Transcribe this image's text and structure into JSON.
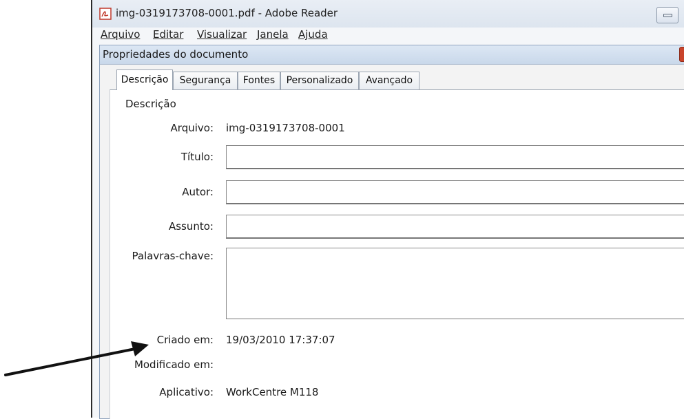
{
  "window": {
    "title": "img-0319173708-0001.pdf - Adobe Reader",
    "icon": "pdf-icon",
    "minimize_icon": "minimize-icon"
  },
  "menu": [
    {
      "label": "Arquivo"
    },
    {
      "label": "Editar"
    },
    {
      "label": "Visualizar"
    },
    {
      "label": "Janela"
    },
    {
      "label": "Ajuda"
    }
  ],
  "dialog": {
    "title": "Propriedades do documento",
    "tabs": [
      {
        "label": "Descrição",
        "active": true
      },
      {
        "label": "Segurança"
      },
      {
        "label": "Fontes"
      },
      {
        "label": "Personalizado"
      },
      {
        "label": "Avançado"
      }
    ],
    "section_label": "Descrição",
    "fields": {
      "arquivo": {
        "label": "Arquivo:",
        "value": "img-0319173708-0001"
      },
      "titulo": {
        "label": "Título:",
        "value": ""
      },
      "autor": {
        "label": "Autor:",
        "value": ""
      },
      "assunto": {
        "label": "Assunto:",
        "value": ""
      },
      "palavras_chave": {
        "label": "Palavras-chave:",
        "value": ""
      },
      "criado_em": {
        "label": "Criado em:",
        "value": "19/03/2010 17:37:07"
      },
      "modificado_em": {
        "label": "Modificado em:",
        "value": ""
      },
      "aplicativo": {
        "label": "Aplicativo:",
        "value": "WorkCentre M118"
      }
    }
  },
  "annotation": {
    "icon": "arrow-annotation",
    "color": "#111111"
  }
}
